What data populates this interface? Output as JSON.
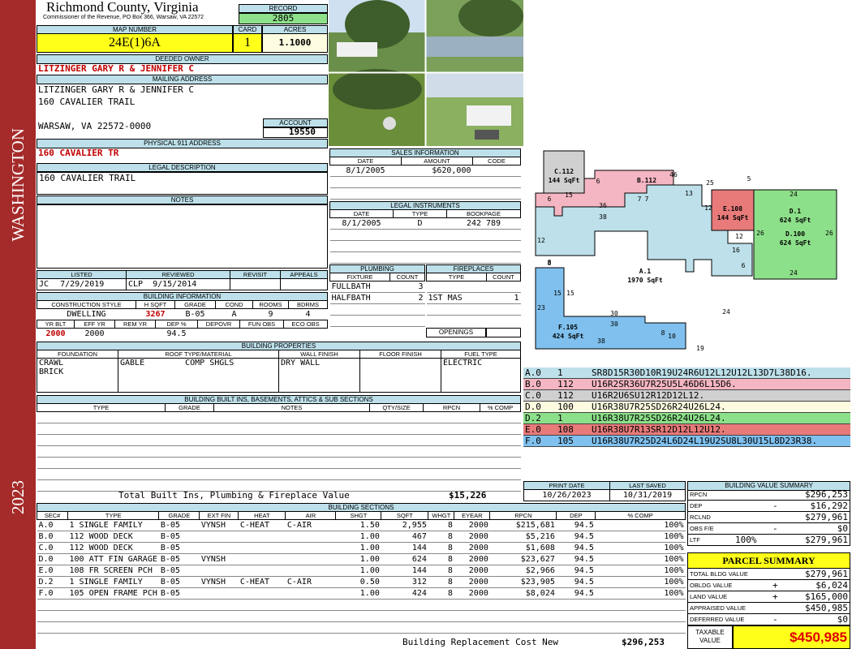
{
  "side": {
    "top": "WASHINGTON",
    "bottom": "2023"
  },
  "header": {
    "county": "Richmond County, Virginia",
    "subtitle": "Commissioner of the Revenue, PO Box 366, Warsaw, VA 22572",
    "record_label": "RECORD",
    "record": "2805",
    "map_label": "MAP NUMBER",
    "map": "24E(1)6A",
    "card_label": "CARD",
    "card": "1",
    "acres_label": "ACRES",
    "acres": "1.1000"
  },
  "owner": {
    "label": "DEEDED OWNER",
    "name": "LITZINGER GARY R & JENNIFER C",
    "mail_label": "MAILING ADDRESS",
    "mail1": "LITZINGER GARY R & JENNIFER C",
    "mail2": "160 CAVALIER TRAIL",
    "mail3": "WARSAW, VA 22572-0000",
    "account_label": "ACCOUNT",
    "account": "19550",
    "phys_label": "PHYSICAL 911 ADDRESS",
    "phys": "160 CAVALIER TR",
    "legal_label": "LEGAL DESCRIPTION",
    "legal": "160 CAVALIER TRAIL",
    "notes_label": "NOTES"
  },
  "sales": {
    "label": "SALES INFORMATION",
    "h_date": "DATE",
    "h_amount": "AMOUNT",
    "h_code": "CODE",
    "date": "8/1/2005",
    "amount": "$620,000",
    "code": ""
  },
  "legal_inst": {
    "label": "LEGAL INSTRUMENTS",
    "h_date": "DATE",
    "h_type": "TYPE",
    "h_book": "BOOKPAGE",
    "date": "8/1/2005",
    "type": "D",
    "book": "242 789"
  },
  "status": {
    "h_listed": "LISTED",
    "h_reviewed": "REVIEWED",
    "h_revisit": "REVISIT",
    "h_appeals": "APPEALS",
    "listed_by": "JC",
    "listed": "7/29/2019",
    "reviewed_by": "CLP",
    "reviewed": "9/15/2014"
  },
  "building": {
    "label": "BUILDING INFORMATION",
    "h_style": "CONSTRUCTION STYLE",
    "h_hsqft": "H SQFT",
    "h_grade": "GRADE",
    "h_cond": "COND",
    "h_rooms": "ROOMS",
    "h_bdrms": "BDRMS",
    "style": "DWELLING",
    "hsqft": "3267",
    "grade": "B-05",
    "cond": "A",
    "rooms": "9",
    "bdrms": "4",
    "h_yrblt": "YR BLT",
    "h_effyr": "EFF YR",
    "h_remyr": "REM YR",
    "h_dep": "DEP %",
    "h_depovr": "DEPOVR",
    "h_funobs": "FUN OBS",
    "h_ecoobs": "ECO OBS",
    "yrblt": "2000",
    "effyr": "2000",
    "dep": "94.5"
  },
  "plumbing": {
    "label": "PLUMBING",
    "h_fixture": "FIXTURE",
    "h_count": "COUNT",
    "rows": [
      {
        "f": "FULLBATH",
        "c": "3"
      },
      {
        "f": "HALFBATH",
        "c": "2"
      }
    ]
  },
  "fireplaces": {
    "label": "FIREPLACES",
    "h_type": "TYPE",
    "h_count": "COUNT",
    "rows": [
      {
        "t": "1ST MAS",
        "c": "1"
      }
    ],
    "openings": "OPENINGS"
  },
  "props": {
    "label": "BUILDING PROPERTIES",
    "h_found": "FOUNDATION",
    "h_roof": "ROOF TYPE/MATERIAL",
    "h_wall": "WALL FINISH",
    "h_floor": "FLOOR FINISH",
    "h_fuel": "FUEL TYPE",
    "found1": "CRAWL",
    "found2": "BRICK",
    "roof1": "GABLE",
    "roof2": "COMP SHGLS",
    "wall": "DRY WALL",
    "floor": "",
    "fuel": "ELECTRIC"
  },
  "builtins": {
    "label": "BUILDING BUILT INS, BASEMENTS, ATTICS & SUB SECTIONS",
    "h_type": "TYPE",
    "h_grade": "GRADE",
    "h_notes": "NOTES",
    "h_qty": "QTY/SIZE",
    "h_rpcn": "RPCN",
    "h_comp": "% COMP",
    "total_label": "Total Built Ins, Plumbing & Fireplace Value",
    "total": "$15,226"
  },
  "sections": {
    "label": "BUILDING SECTIONS",
    "headers": [
      "SEC#",
      "TYPE",
      "GRADE",
      "EXT FIN",
      "HEAT",
      "AIR",
      "SHGT",
      "SQFT",
      "WHGT",
      "EYEAR",
      "RPCN",
      "DEP",
      "% COMP"
    ],
    "rows": [
      [
        "A.0",
        "1 SINGLE FAMILY",
        "B-05",
        "VYNSH",
        "C-HEAT",
        "C-AIR",
        "1.50",
        "2,955",
        "8",
        "2000",
        "$215,681",
        "94.5",
        "100%"
      ],
      [
        "B.0",
        "112 WOOD DECK",
        "B-05",
        "",
        "",
        "",
        "1.00",
        "467",
        "8",
        "2000",
        "$5,216",
        "94.5",
        "100%"
      ],
      [
        "C.0",
        "112 WOOD DECK",
        "B-05",
        "",
        "",
        "",
        "1.00",
        "144",
        "8",
        "2000",
        "$1,608",
        "94.5",
        "100%"
      ],
      [
        "D.0",
        "100 ATT FIN GARAGE",
        "B-05",
        "VYNSH",
        "",
        "",
        "1.00",
        "624",
        "8",
        "2000",
        "$23,627",
        "94.5",
        "100%"
      ],
      [
        "E.0",
        "108 FR SCREEN PCH",
        "B-05",
        "",
        "",
        "",
        "1.00",
        "144",
        "8",
        "2000",
        "$2,966",
        "94.5",
        "100%"
      ],
      [
        "D.2",
        "1 SINGLE FAMILY",
        "B-05",
        "VYNSH",
        "C-HEAT",
        "C-AIR",
        "0.50",
        "312",
        "8",
        "2000",
        "$23,905",
        "94.5",
        "100%"
      ],
      [
        "F.0",
        "105 OPEN FRAME PCH",
        "B-05",
        "",
        "",
        "",
        "1.00",
        "424",
        "8",
        "2000",
        "$8,024",
        "94.5",
        "100%"
      ]
    ],
    "rcn_label": "Building Replacement Cost New",
    "rcn": "$296,253"
  },
  "sketch": {
    "labels": [
      {
        "t": "C.112",
        "s": "144 SqFt"
      },
      {
        "t": "B.112",
        "s": ""
      },
      {
        "t": "E.108",
        "s": "144 SqFt"
      },
      {
        "t": "D.1",
        "s": "624 SqFt"
      },
      {
        "t": "D.100",
        "s": "624 SqFt"
      },
      {
        "t": "A.1",
        "s": "1970 SqFt"
      },
      {
        "t": "F.105",
        "s": "424 SqFt"
      }
    ],
    "dims": [
      "15",
      "6",
      "46",
      "25",
      "5",
      "6",
      "36",
      "7",
      "7",
      "13",
      "12",
      "24",
      "38",
      "26",
      "26",
      "12",
      "16",
      "12",
      "6",
      "8",
      "15",
      "15",
      "23",
      "30",
      "30",
      "8",
      "10",
      "19",
      "38",
      "24",
      "24",
      "8"
    ]
  },
  "vectors": [
    {
      "sec": "A.0",
      "n": "1",
      "code": "SR8D15R30D10R19U24R6U12L12U12L13D7L38D16.",
      "color": "#bde0ea"
    },
    {
      "sec": "B.0",
      "n": "112",
      "code": "U16R2SR36U7R25U5L46D6L15D6.",
      "color": "#f4b6c2"
    },
    {
      "sec": "C.0",
      "n": "112",
      "code": "U16R2U6SU12R12D12L12.",
      "color": "#d0d0d0"
    },
    {
      "sec": "D.0",
      "n": "100",
      "code": "U16R38U7R25SD26R24U26L24.",
      "color": "#fdfbe0"
    },
    {
      "sec": "D.2",
      "n": "1",
      "code": "U16R38U7R25SD26R24U26L24.",
      "color": "#8de08a"
    },
    {
      "sec": "E.0",
      "n": "108",
      "code": "U16R38U7R13SR12D12L12U12.",
      "color": "#e87a7a"
    },
    {
      "sec": "F.0",
      "n": "105",
      "code": "U16R38U7R25D24L6D24L19U2SU8L30U15L8D23R38.",
      "color": "#7fc0ee"
    }
  ],
  "dates": {
    "h_print": "PRINT DATE",
    "h_saved": "LAST SAVED",
    "print": "10/26/2023",
    "saved": "10/31/2019"
  },
  "bvs": {
    "label": "BUILDING VALUE SUMMARY",
    "rows": [
      {
        "k": "RPCN",
        "s": "",
        "v": "$296,253"
      },
      {
        "k": "DEP",
        "s": "-",
        "v": "$16,292"
      },
      {
        "k": "RCLND",
        "s": "",
        "v": "$279,961"
      },
      {
        "k": "OBS F/E",
        "s": "-",
        "v": "$0"
      },
      {
        "k": "LTF",
        "p": "100%",
        "s": "",
        "v": "$279,961"
      }
    ]
  },
  "parcel": {
    "label": "PARCEL SUMMARY",
    "rows": [
      {
        "k": "TOTAL BLDG VALUE",
        "s": "",
        "v": "$279,961"
      },
      {
        "k": "OBLDG VALUE",
        "s": "+",
        "v": "$6,024"
      },
      {
        "k": "LAND VALUE",
        "s": "+",
        "v": "$165,000"
      },
      {
        "k": "APPRAISED VALUE",
        "s": "",
        "v": "$450,985"
      },
      {
        "k": "DEFERRED VALUE",
        "s": "-",
        "v": "$0"
      }
    ],
    "taxable_label1": "TAXABLE",
    "taxable_label2": "VALUE",
    "taxable": "$450,985"
  }
}
